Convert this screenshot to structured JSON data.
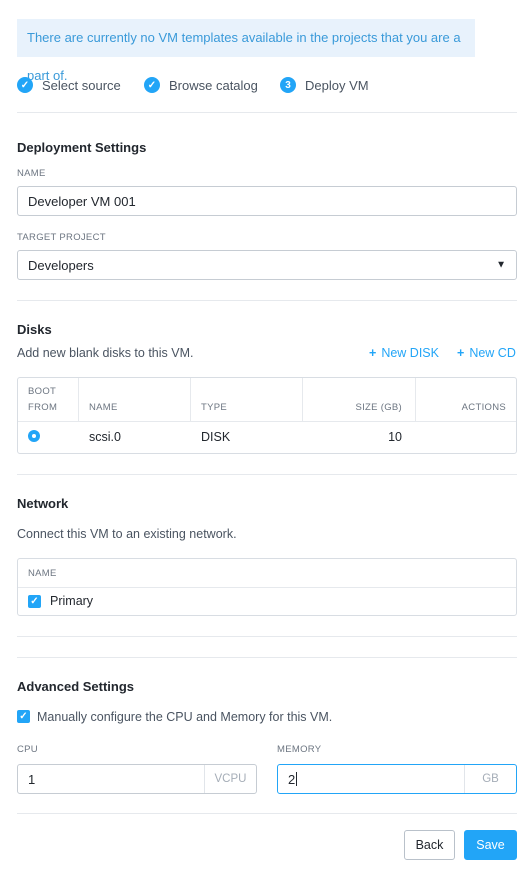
{
  "banner": {
    "text": "There are currently no VM templates available in the projects that you are a part of."
  },
  "steps": [
    {
      "label": "Select source",
      "icon": "check-icon",
      "state": "complete"
    },
    {
      "label": "Browse catalog",
      "icon": "check-icon",
      "state": "complete"
    },
    {
      "label": "Deploy VM",
      "number": "3",
      "state": "current"
    }
  ],
  "deployment": {
    "title": "Deployment Settings",
    "name_label": "NAME",
    "name_value": "Developer VM 001",
    "project_label": "TARGET PROJECT",
    "project_value": "Developers"
  },
  "disks": {
    "title": "Disks",
    "description": "Add new blank disks to this VM.",
    "new_disk_label": "New DISK",
    "new_cd_label": "New CD",
    "columns": {
      "boot_line1": "BOOT",
      "boot_line2": "FROM",
      "name": "NAME",
      "type": "TYPE",
      "size": "SIZE (GB)",
      "actions": "ACTIONS"
    },
    "rows": [
      {
        "name": "scsi.0",
        "type": "DISK",
        "size": "10",
        "boot": true
      }
    ]
  },
  "network": {
    "title": "Network",
    "description": "Connect this VM to an existing network.",
    "column_name": "NAME",
    "rows": [
      {
        "name": "Primary",
        "checked": true
      }
    ]
  },
  "advanced": {
    "title": "Advanced Settings",
    "manual_label": "Manually configure the CPU and Memory for this VM.",
    "manual_checked": true,
    "cpu_label": "CPU",
    "cpu_value": "1",
    "cpu_unit": "VCPU",
    "memory_label": "MEMORY",
    "memory_value": "2",
    "memory_unit": "GB"
  },
  "footer": {
    "back_label": "Back",
    "save_label": "Save"
  },
  "colors": {
    "accent": "#22a5f7",
    "banner_bg": "#e8f2fc",
    "banner_text": "#3a9ad9"
  }
}
